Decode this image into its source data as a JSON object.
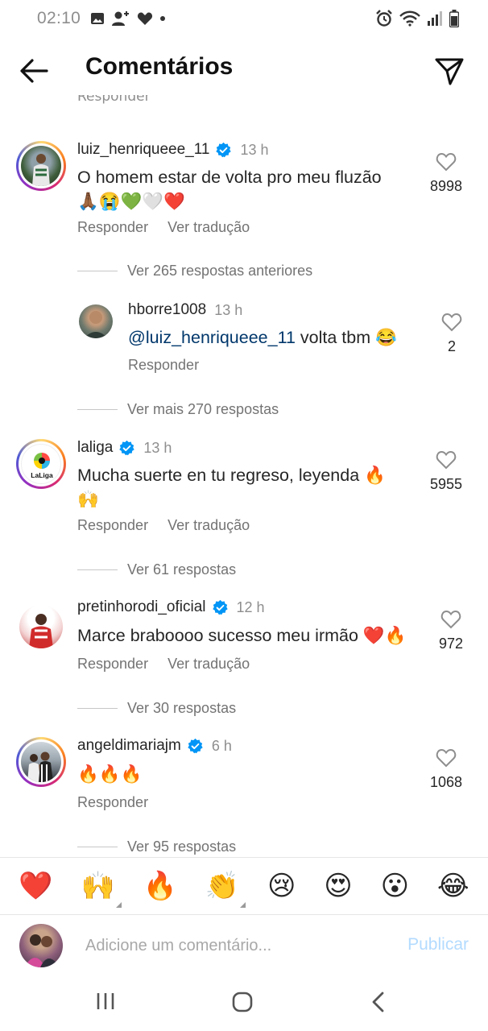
{
  "status_bar": {
    "time": "02:10"
  },
  "header": {
    "title": "Comentários"
  },
  "partial_reply_label": "Responder",
  "comments": [
    {
      "username": "luiz_henriqueee_11",
      "verified": true,
      "time": "13 h",
      "text_line1": "O homem estar de volta pro meu fluzão",
      "text_line2": "🙏🏾😭💚🤍❤️",
      "likes": "8998",
      "reply_label": "Responder",
      "translate_label": "Ver tradução",
      "view_replies": "Ver 265 respostas anteriores"
    },
    {
      "username": "hborre1008",
      "time": "13 h",
      "mention": "@luiz_henriqueee_11",
      "text_rest": " volta tbm 😂",
      "likes": "2",
      "reply_label": "Responder",
      "view_replies": "Ver mais 270 respostas"
    },
    {
      "username": "laliga",
      "verified": true,
      "time": "13 h",
      "text_line1": "Mucha suerte en tu regreso, leyenda 🔥",
      "text_line2": "🙌",
      "likes": "5955",
      "reply_label": "Responder",
      "translate_label": "Ver tradução",
      "view_replies": "Ver 61 respostas",
      "avatar_text": "LaLiga"
    },
    {
      "username": "pretinhorodi_oficial",
      "verified": true,
      "time": "12 h",
      "text_line1": "Marce braboooo sucesso meu irmão ❤️🔥",
      "likes": "972",
      "reply_label": "Responder",
      "translate_label": "Ver tradução",
      "view_replies": "Ver 30 respostas"
    },
    {
      "username": "angeldimariajm",
      "verified": true,
      "time": "6 h",
      "text_line1": "🔥🔥🔥",
      "likes": "1068",
      "reply_label": "Responder",
      "view_replies": "Ver 95 respostas"
    }
  ],
  "emoji_bar": [
    "❤️",
    "🙌",
    "🔥",
    "👏",
    "😢",
    "😍",
    "😮",
    "😂"
  ],
  "compose": {
    "placeholder": "Adicione um comentário...",
    "publish_label": "Publicar"
  },
  "colors": {
    "verified": "#0095f6",
    "publish_disabled": "#b3dbff",
    "secondary_text": "#737373"
  }
}
